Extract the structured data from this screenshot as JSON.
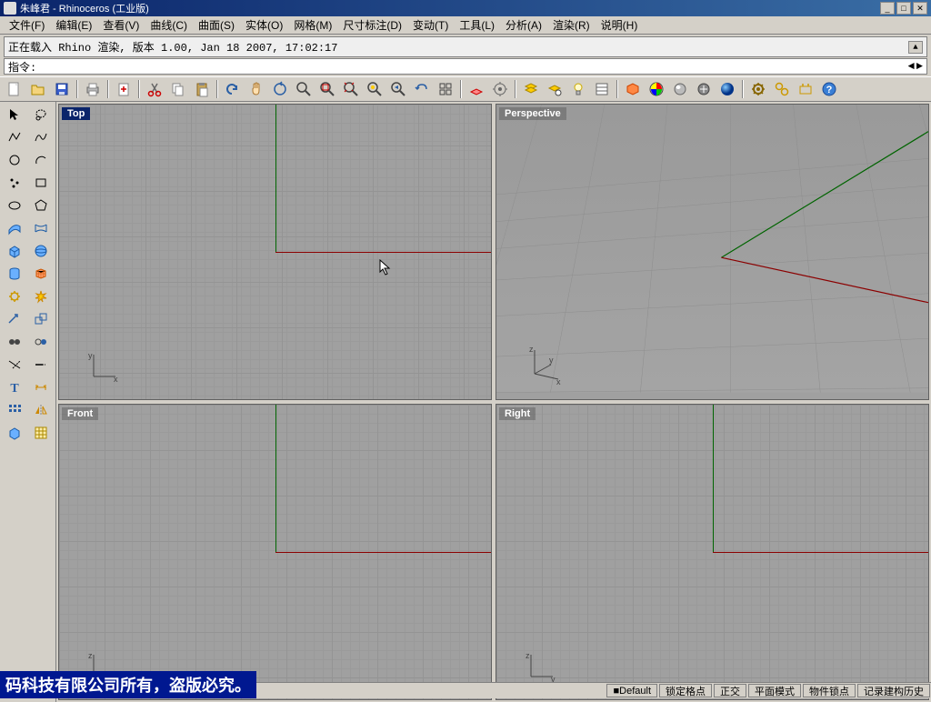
{
  "title_bar": {
    "prefix": "朱峰君",
    "app": "Rhinoceros (工业版)"
  },
  "menu": {
    "file": "文件(F)",
    "edit": "编辑(E)",
    "view": "查看(V)",
    "curve": "曲线(C)",
    "surface": "曲面(S)",
    "solid": "实体(O)",
    "mesh": "网格(M)",
    "dimension": "尺寸标注(D)",
    "transform": "变动(T)",
    "tools": "工具(L)",
    "analyze": "分析(A)",
    "render": "渲染(R)",
    "help": "说明(H)"
  },
  "history": {
    "text": "正在载入 Rhino 渲染, 版本 1.00, Jan 18 2007, 17:02:17"
  },
  "command": {
    "label": "指令:",
    "value": ""
  },
  "viewports": {
    "top": "Top",
    "perspective": "Perspective",
    "front": "Front",
    "right": "Right"
  },
  "axes": {
    "x": "x",
    "y": "y",
    "z": "z"
  },
  "status": {
    "layers_default": "Default",
    "snap": "锁定格点",
    "ortho": "正交",
    "planar": "平面模式",
    "osnap": "物件锁点",
    "record_history": "记录建构历史"
  },
  "watermark": "码科技有限公司所有，盗版必究。",
  "toolbar_icons": {
    "new": "new-icon",
    "open": "open-icon",
    "save": "save-icon",
    "print": "print-icon",
    "copy_clip": "clipboard-export-icon",
    "cut": "cut-icon",
    "copy": "copy-icon",
    "paste": "paste-icon",
    "undo": "undo-icon",
    "redo": "redo-icon",
    "pan": "pan-icon",
    "rotate_view": "rotate-view-icon",
    "zoom_extents": "zoom-extents-icon",
    "zoom_window": "zoom-window-icon",
    "zoom_dynamic": "zoom-dynamic-icon",
    "zoom_sel": "zoom-selected-icon",
    "zoom_prev": "zoom-previous-icon",
    "zoom_in": "zoom-in-icon",
    "four_view": "four-viewport-icon",
    "cplane": "cplane-icon",
    "set_view": "set-view-icon",
    "layer_1": "layer-edit-icon",
    "layer_2": "layer-states-icon",
    "light": "light-icon",
    "props": "properties-icon",
    "render": "render-icon",
    "mat_rgb": "material-color-icon",
    "shade": "shade-icon",
    "render_opts": "render-options-icon",
    "sphere_shade": "sphere-shade-icon",
    "options": "options-icon",
    "options2": "options2-icon",
    "plugin": "plugin-icon",
    "help": "help-icon"
  }
}
